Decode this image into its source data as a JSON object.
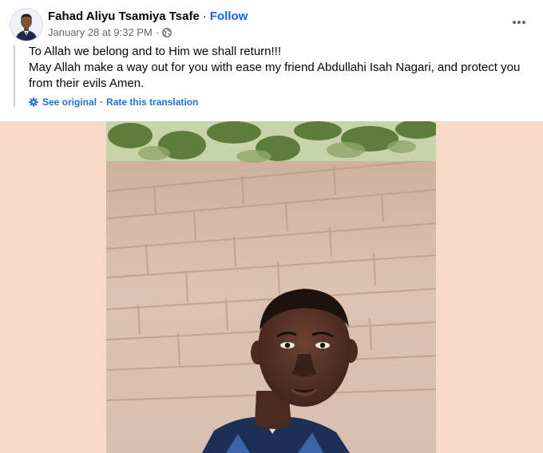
{
  "post": {
    "author": {
      "name": "Fahad Aliyu Tsamiya Tsafe",
      "separator": "·",
      "follow_label": "Follow"
    },
    "meta": {
      "timestamp": "January 28 at 9:32 PM",
      "separator": "·",
      "audience_icon": "globe-icon"
    },
    "more_icon": "more-options-icon",
    "text_lines": [
      "To Allah we belong and to Him we shall return!!!",
      "May Allah make a way out for you with ease my friend Abdullahi Isah Nagari, and protect you from their evils Amen."
    ],
    "translation": {
      "icon": "gear-icon",
      "see_original": "See original",
      "separator": "·",
      "rate": "Rate this translation"
    },
    "media": {
      "background_color": "#f6d9c6",
      "subject": "selfie photo"
    }
  },
  "colors": {
    "link_blue": "#0866ff",
    "translation_blue": "#216fdb",
    "secondary_text": "#65676b"
  }
}
